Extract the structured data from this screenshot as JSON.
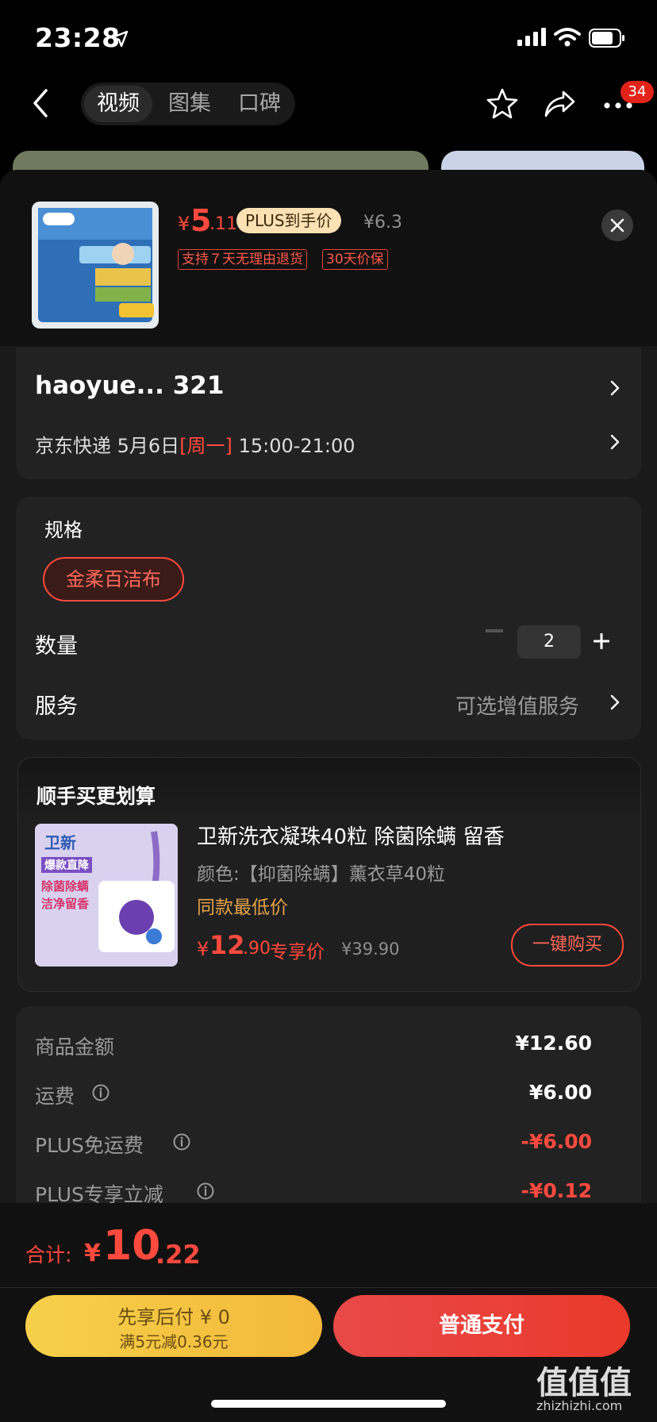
{
  "status_bar": {
    "time": "23:28"
  },
  "nav": {
    "tabs": [
      {
        "label": "视频"
      },
      {
        "label": "图集"
      },
      {
        "label": "口碑"
      }
    ],
    "badge_count": "34"
  },
  "product": {
    "price_symbol": "¥",
    "price_int": "5",
    "price_dec": ".11",
    "plus_tag": "PLUS到手价",
    "orig_price": "¥6.3",
    "service_tags": [
      "支持７天无理由退货",
      "30天价保"
    ]
  },
  "address": {
    "name": "haoyue...  321",
    "carrier": "京东快递",
    "date": "5月6日",
    "weekday": "[周一]",
    "slot": "15:00-21:00"
  },
  "spec": {
    "label": "规格",
    "option": "金柔百洁布",
    "qty_label": "数量",
    "qty_value": "2",
    "service_label": "服务",
    "service_value": "可选增值服务"
  },
  "upsell": {
    "title": "顺手买更划算",
    "name": "卫新洗衣凝珠40粒 除菌除螨 留香",
    "attr": "颜色:【抑菌除螨】薰衣草40粒",
    "low_price_note": "同款最低价",
    "price_symbol": "¥",
    "price_int": "12",
    "price_dec": ".90",
    "exclusive": "专享价",
    "orig_price": "¥39.90",
    "buy_button": "一键购买",
    "img_text": [
      "卫新",
      "爆款直降",
      "除菌除螨",
      "洁净留香"
    ]
  },
  "summary": {
    "rows": [
      {
        "label": "商品金额",
        "value": "¥12.60"
      },
      {
        "label": "运费",
        "value": "¥6.00"
      },
      {
        "label": "PLUS免运费",
        "value": "-¥6.00"
      },
      {
        "label": "PLUS专享立减",
        "value": "-¥0.12"
      }
    ]
  },
  "bottom": {
    "total_label": "合计:",
    "total_symbol": "¥",
    "total_int": "10",
    "total_dec": ".22",
    "pay_later_line1": "先享后付 ¥ 0",
    "pay_later_line2": "满5元减0.36元",
    "pay_normal": "普通支付"
  },
  "watermark": {
    "main": "值值值",
    "sub": "zhizhizhi.com"
  },
  "colors": {
    "accent_red": "#ff4a3d",
    "plus_gold": "#fbe1b3",
    "pay_later_yellow": "#f6d04a"
  }
}
